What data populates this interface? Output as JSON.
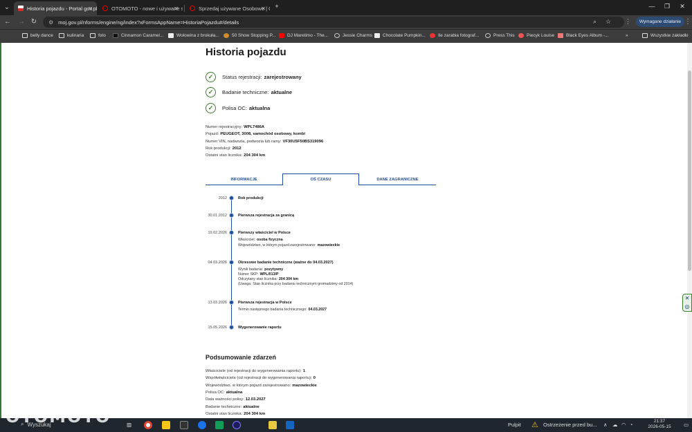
{
  "browser": {
    "tabs": [
      {
        "title": "Historia pojazdu - Portal gov.pl",
        "icon": "gov-pl-flag-icon",
        "color": "#d32f2f"
      },
      {
        "title": "OTOMOTO - nowe i używane s...",
        "icon": "otomoto-icon",
        "color": "#e00"
      },
      {
        "title": "Sprzedaj używane Osobowe | O...",
        "icon": "otomoto-icon",
        "color": "#e00"
      }
    ],
    "new_tab": "+",
    "url": "moj.gov.pl/nforms/engine/ng/index?xFormsAppName=HistoriaPojazdu#/details",
    "required_action": "Wymagane działanie",
    "bookmarks": [
      {
        "label": "belly dance",
        "icon": "folder-icon",
        "color": "#ddd"
      },
      {
        "label": "kulinaria",
        "icon": "folder-icon",
        "color": "#ddd"
      },
      {
        "label": "foto",
        "icon": "folder-icon",
        "color": "#ddd"
      },
      {
        "label": "Cinnamon Caramel...",
        "icon": "site-icon",
        "color": "#222"
      },
      {
        "label": "Wołowina z brokuła...",
        "icon": "site-icon",
        "color": "#eee"
      },
      {
        "label": "50 Show Stopping P...",
        "icon": "site-icon",
        "color": "#d08b2d"
      },
      {
        "label": "DJ Maretimo - The...",
        "icon": "youtube-icon",
        "color": "#f00"
      },
      {
        "label": "Jessie Charms",
        "icon": "globe-icon",
        "color": "#ccc"
      },
      {
        "label": "Chocolate Pumpkin...",
        "icon": "site-icon",
        "color": "#eee"
      },
      {
        "label": "Ile zarabia fotograf...",
        "icon": "site-icon",
        "color": "#e33"
      },
      {
        "label": "Press This",
        "icon": "globe-icon",
        "color": "#ccc"
      },
      {
        "label": "Piecyk Louise",
        "icon": "site-icon",
        "color": "#e55"
      },
      {
        "label": "Black Eyes Album -...",
        "icon": "site-icon",
        "color": "#e77"
      },
      {
        "label": "Wszystkie zakładki",
        "icon": "folder-icon",
        "color": "#ddd"
      }
    ],
    "more_bookmarks": "»"
  },
  "page": {
    "title": "Historia pojazdu",
    "statuses": [
      {
        "label": "Status rejestracji:",
        "value": "zarejestrowany"
      },
      {
        "label": "Badanie techniczne:",
        "value": "aktualne"
      },
      {
        "label": "Polisa OC:",
        "value": "aktualna"
      }
    ],
    "vehicle_info": [
      {
        "label": "Numer rejestracyjny:",
        "value": "WPL7486A"
      },
      {
        "label": "Pojazd:",
        "value": "PEUGEOT, 3008, samochód osobowy, kombi"
      },
      {
        "label": "Numer VIN, nadwozia, podwozia lub ramy:",
        "value": "VF30U5F50BS319096"
      },
      {
        "label": "Rok produkcji:",
        "value": "2012"
      },
      {
        "label": "Ostatni stan licznika:",
        "value": "204 304 km"
      }
    ],
    "tabs": [
      {
        "label": "INFORMACJE",
        "selected": false
      },
      {
        "label": "OŚ CZASU",
        "selected": true
      },
      {
        "label": "DANE ZAGRANICZNE",
        "selected": false
      }
    ],
    "timeline": [
      {
        "date": "2012",
        "title": "Rok produkcji",
        "details": []
      },
      {
        "date": "30.01.2012",
        "title": "Pierwsza rejestracja za granicą",
        "details": []
      },
      {
        "date": "19.02.2026",
        "title": "Pierwszy właściciel w Polsce",
        "details": [
          {
            "label": "Właściciel:",
            "value": "osoba fizyczna"
          },
          {
            "label": "Województwo, w którym pojazd zarejestrowano:",
            "value": "mazowieckie"
          }
        ]
      },
      {
        "date": "04.03.2026",
        "title": "Okresowe badanie techniczne (ważne do 04.03.2027)",
        "details": [
          {
            "label": "Wynik badania:",
            "value": "pozytywny"
          },
          {
            "label": "Numer SKP:",
            "value": "WPL/013/P"
          },
          {
            "label": "Odczytany stan licznika:",
            "value": "204 304 km"
          },
          {
            "label": "(Uwaga: Stan licznika przy badaniu technicznym gromadzimy od 2014)",
            "value": ""
          }
        ]
      },
      {
        "date": "13.03.2026",
        "title": "Pierwsza rejestracja w Polsce",
        "details": [
          {
            "label": "Termin następnego badania technicznego:",
            "value": "04.03.2027"
          }
        ]
      },
      {
        "date": "15.05.2026",
        "title": "Wygenerowanie raportu",
        "details": []
      }
    ],
    "summary_title": "Podsumowanie zdarzeń",
    "summary": [
      {
        "label": "Właściciele (od rejestracji do wygenerowania raportu):",
        "value": "1"
      },
      {
        "label": "Współwłaściciele (od rejestracji do wygenerowania raportu):",
        "value": "0"
      },
      {
        "label": "Województwo, w którym pojazd zarejestrowano:",
        "value": "mazowieckie"
      },
      {
        "label": "Polisa OC:",
        "value": "aktualna"
      },
      {
        "label": "Data ważności polisy:",
        "value": "12.03.2027"
      },
      {
        "label": "Badanie techniczne:",
        "value": "aktualne"
      },
      {
        "label": "Ostatni stan licznika:",
        "value": "204 304 km"
      }
    ]
  },
  "taskbar": {
    "watermark": "OTOMOTO",
    "search": "Wyszukaj",
    "desktop": "Pulpit",
    "notification": "Ostrzeżenie przed bu...",
    "time": "21:37",
    "date": "2026-05-15"
  },
  "colors": {
    "accent": "#1b4f9a",
    "check": "#3c7f2a",
    "chrome": "#1f1f1f"
  }
}
